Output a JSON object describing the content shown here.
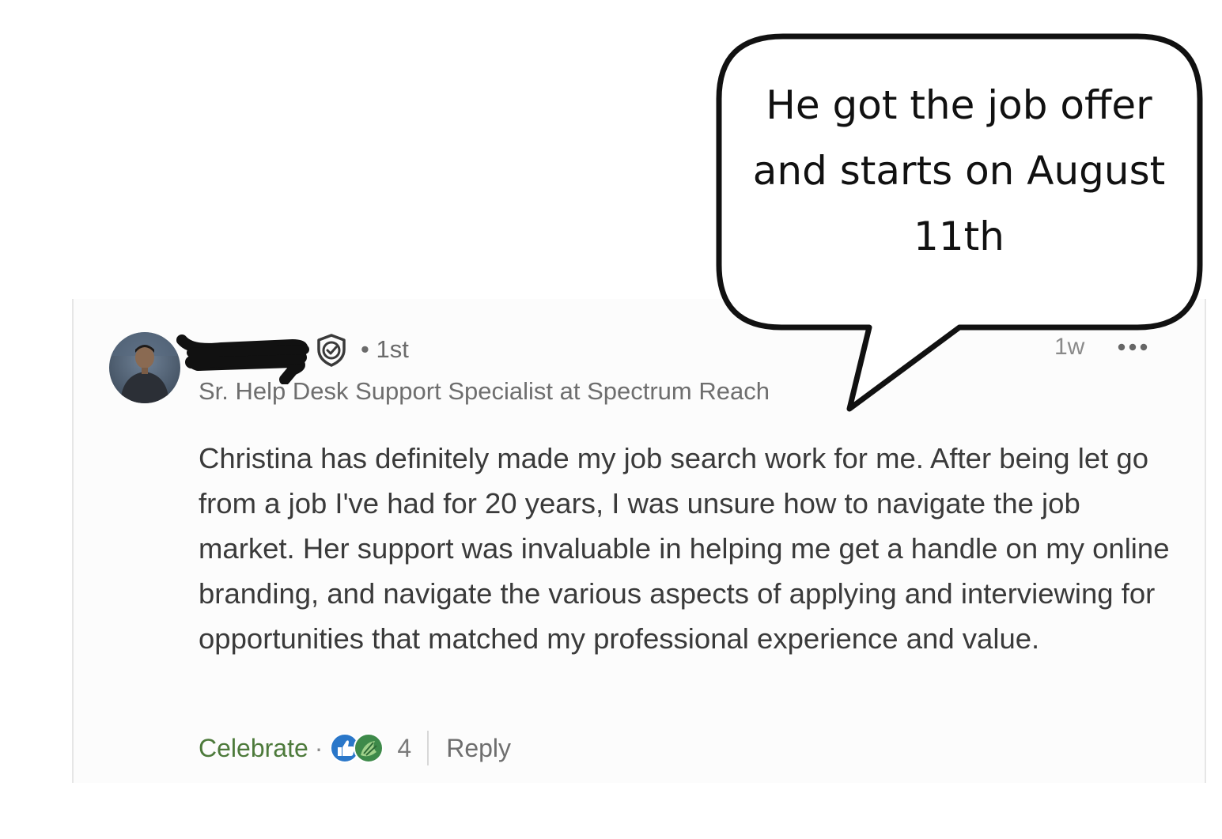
{
  "comment": {
    "degree": "• 1st",
    "headline": "Sr. Help Desk Support Specialist at Spectrum Reach",
    "timestamp": "1w",
    "body": "Christina has definitely made my job search work for me. After being let go from a job I've had for 20 years, I was unsure how to navigate the job market. Her support was invaluable in helping me get a handle on my online branding, and navigate the various aspects of applying and interviewing for opportunities that matched my professional experience and value.",
    "actions": {
      "celebrate_label": "Celebrate",
      "separator": "·",
      "reaction_count": "4",
      "reply_label": "Reply"
    },
    "icons": [
      "avatar",
      "redaction-scribble",
      "verified-shield-icon",
      "more-options-icon",
      "like-reaction-icon",
      "celebrate-reaction-icon"
    ]
  },
  "callout": {
    "text": "He got the job offer and starts on August 11th"
  },
  "colors": {
    "celebrate": "#4d7a3b",
    "like_blue": "#2a77c9",
    "celebrate_green": "#3e8a4a",
    "text": "#3a3a3a",
    "muted": "#6e6e6e"
  }
}
